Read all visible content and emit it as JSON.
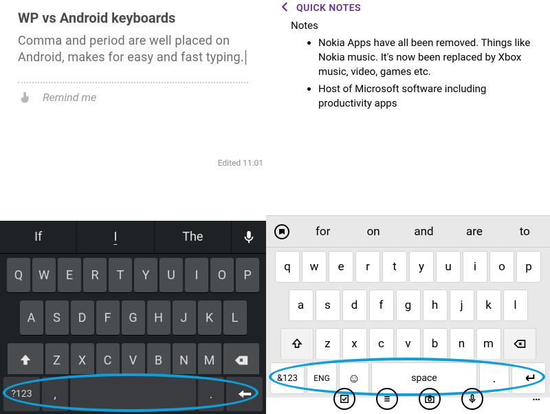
{
  "android": {
    "title": "WP vs Android keyboards",
    "body": "Comma and period are well placed on Android, makes for easy and fast typing.",
    "remind": "Remind me",
    "edited": "Edited 11:01",
    "suggestions": [
      "If",
      "I",
      "The"
    ],
    "rows": {
      "r1": [
        "Q",
        "W",
        "E",
        "R",
        "T",
        "Y",
        "U",
        "I",
        "O",
        "P"
      ],
      "r2": [
        "A",
        "S",
        "D",
        "F",
        "G",
        "H",
        "J",
        "K",
        "L"
      ],
      "r3": [
        "Z",
        "X",
        "C",
        "V",
        "B",
        "N",
        "M"
      ]
    },
    "bottom": {
      "sym": "?123",
      "comma": ",",
      "period": "."
    }
  },
  "wp": {
    "section": "QUICK NOTES",
    "label": "Notes",
    "bullets": [
      "Nokia Apps have all been removed. Things like Nokia music. It's now been replaced by Xbox music, video, games etc.",
      "Host of Microsoft software including productivity apps"
    ],
    "suggestions": [
      "for",
      "on",
      "and",
      "are",
      "to"
    ],
    "rows": {
      "r1": [
        "q",
        "w",
        "e",
        "r",
        "t",
        "y",
        "u",
        "i",
        "o",
        "p"
      ],
      "r2": [
        "a",
        "s",
        "d",
        "f",
        "g",
        "h",
        "j",
        "k",
        "l"
      ],
      "r3": [
        "z",
        "x",
        "c",
        "v",
        "b",
        "n",
        "m"
      ]
    },
    "bottom": {
      "sym": "&123",
      "lang": "ENG",
      "emoji": "☺",
      "space": "space",
      "period": "."
    },
    "dots": "…"
  }
}
